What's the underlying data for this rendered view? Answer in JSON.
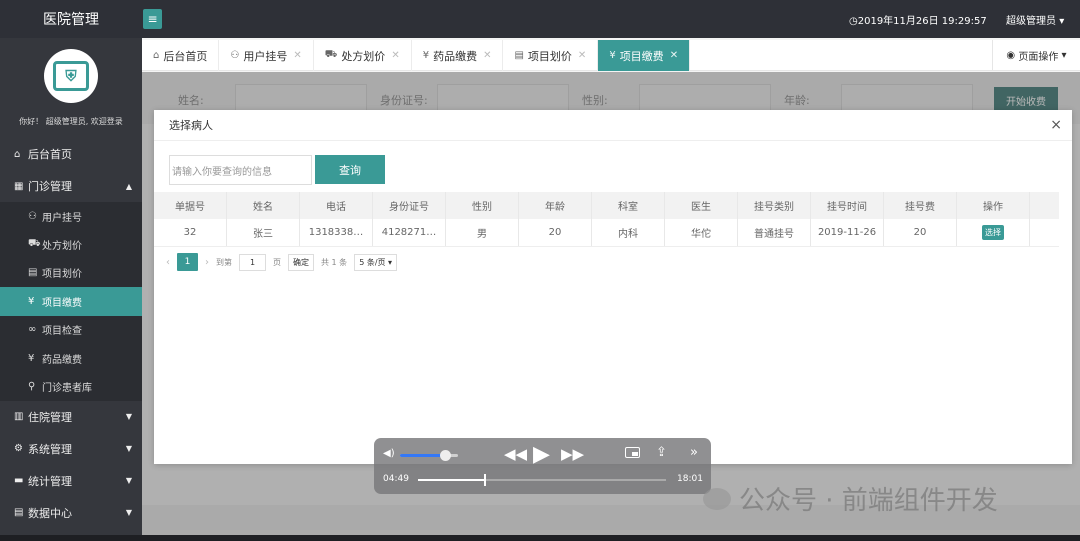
{
  "app": {
    "title": "医院管理",
    "menu_toggle_icon": "≡"
  },
  "header": {
    "datetime": "2019年11月26日 19:29:57",
    "user_menu": "超级管理员"
  },
  "sidebar": {
    "welcome": "你好！ 超级管理员, 欢迎登录",
    "home": "后台首页",
    "outpatient": {
      "label": "门诊管理",
      "items": [
        "用户挂号",
        "处方划价",
        "项目划价",
        "项目缴费",
        "项目检查",
        "药品缴费",
        "门诊患者库"
      ]
    },
    "inpatient": "住院管理",
    "system": "系统管理",
    "stats": "统计管理",
    "data_center": "数据中心"
  },
  "tabs": [
    {
      "label": "后台首页",
      "icon": "home-icon"
    },
    {
      "label": "用户挂号",
      "icon": "user-icon"
    },
    {
      "label": "处方划价",
      "icon": "cart-icon"
    },
    {
      "label": "药品缴费",
      "icon": "yen-icon"
    },
    {
      "label": "项目划价",
      "icon": "file-icon"
    },
    {
      "label": "项目缴费",
      "icon": "yen-icon"
    }
  ],
  "page_ops": "页面操作",
  "form": {
    "name_label": "姓名:",
    "id_label": "身份证号:",
    "gender_label": "性别:",
    "age_label": "年龄:",
    "start_button": "开始收费"
  },
  "modal": {
    "title": "选择病人",
    "close": "×",
    "search_placeholder": "请输入你要查询的信息",
    "search_button": "查询",
    "columns": [
      "单据号",
      "姓名",
      "电话",
      "身份证号",
      "性别",
      "年龄",
      "科室",
      "医生",
      "挂号类别",
      "挂号时间",
      "挂号费",
      "操作"
    ],
    "rows": [
      [
        "32",
        "张三",
        "1318338…",
        "4128271…",
        "男",
        "20",
        "内科",
        "华佗",
        "普通挂号",
        "2019-11-26",
        "20",
        "选择"
      ]
    ],
    "pager": {
      "current": "1",
      "goto_label": "到第",
      "page_input": "1",
      "page_unit": "页",
      "confirm": "确定",
      "total": "共 1 条",
      "page_size": "5 条/页"
    }
  },
  "player": {
    "current_time": "04:49",
    "duration": "18:01",
    "progress": 0.267,
    "volume": 0.78
  },
  "watermark": "公众号 · 前端组件开发",
  "colors": {
    "accent": "#3a9a96",
    "sidebar": "#35373d",
    "topbar": "#2e3037"
  }
}
